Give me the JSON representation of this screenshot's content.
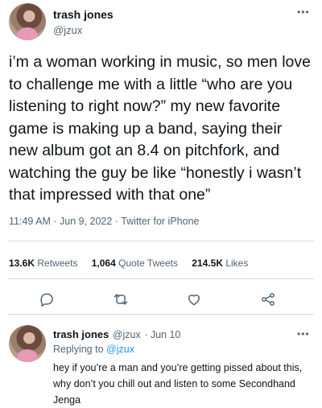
{
  "main_tweet": {
    "author_name": "trash jones",
    "author_handle": "@jzux",
    "more_icon": "more-dots-icon",
    "text": "i’m a woman working in music, so men love\nto challenge me with a little “who are you\nlistening to right now?” my new favorite\ngame is making up a band, saying their\nnew album got an 8.4 on pitchfork, and\nwatching the guy be like “honestly i wasn’t\nthat impressed with that one”",
    "timestamp": "11:49 AM · Jun 9, 2022 · Twitter for iPhone"
  },
  "stats": {
    "retweets_count": "13.6K",
    "retweets_label": "Retweets",
    "quotes_count": "1,064",
    "quotes_label": "Quote Tweets",
    "likes_count": "214.5K",
    "likes_label": "Likes"
  },
  "actions": {
    "reply_icon": "comment-icon",
    "retweet_icon": "retweet-icon",
    "like_icon": "heart-icon",
    "share_icon": "share-icon"
  },
  "reply": {
    "author_name": "trash jones",
    "author_handle": "@jzux",
    "date": "· Jun 10",
    "replying_prefix": "Replying to",
    "replying_handle": "@jzux",
    "text": "hey if you’re a man and you’re getting pissed about this,\nwhy don’t you chill out and listen to some Secondhand\nJenga"
  },
  "colors": {
    "text": "#0f1419",
    "secondary": "#536471",
    "accent": "#1d9bf0",
    "divider": "#cfd9de"
  }
}
